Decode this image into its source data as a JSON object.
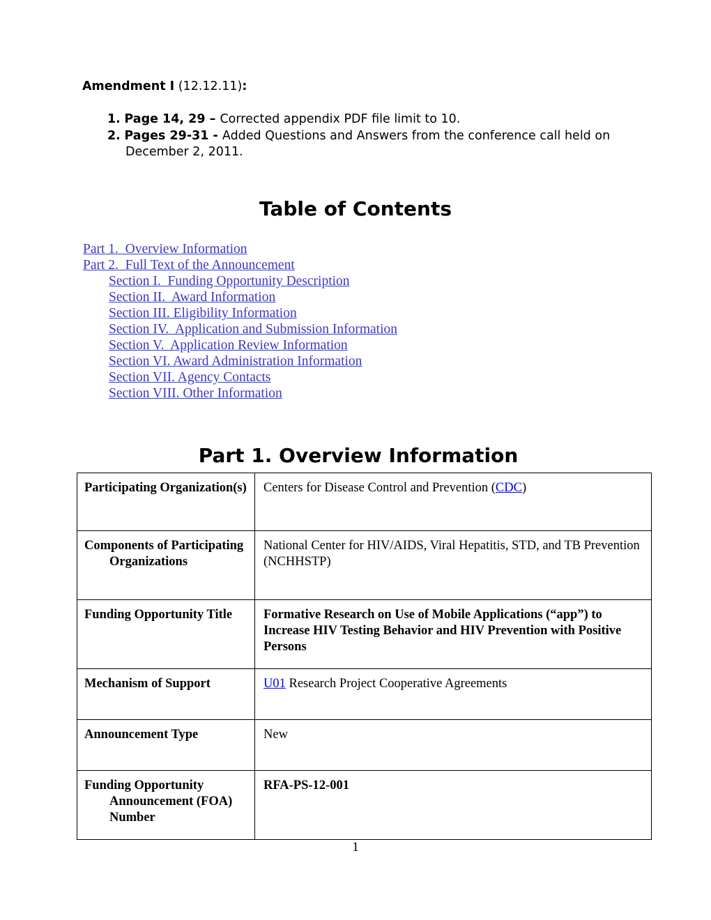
{
  "amendment": {
    "heading_strong": "Amendment I",
    "heading_plain": " (12.12.11)",
    "heading_colon": ":",
    "items": [
      {
        "number": "1.",
        "lead": "Page 14, 29 – ",
        "rest": "Corrected appendix PDF file limit to 10."
      },
      {
        "number": "2.",
        "lead": "Pages 29-31 - ",
        "rest": "Added Questions and Answers from the conference call held on December 2, 2011."
      }
    ]
  },
  "toc": {
    "heading": "Table of Contents",
    "link_color": "#3838C8",
    "entries": [
      {
        "label": "Part 1.  Overview Information",
        "level": 1
      },
      {
        "label": "Part 2.  Full Text of the Announcement",
        "level": 1
      },
      {
        "label": "Section I.  Funding Opportunity Description",
        "level": 2
      },
      {
        "label": "Section II.  Award Information",
        "level": 2
      },
      {
        "label": "Section III. Eligibility Information",
        "level": 2
      },
      {
        "label": "Section IV.  Application and Submission Information",
        "level": 2
      },
      {
        "label": "Section V.  Application Review Information",
        "level": 2
      },
      {
        "label": "Section VI. Award Administration Information",
        "level": 2
      },
      {
        "label": "Section VII. Agency Contacts",
        "level": 2
      },
      {
        "label": "Section VIII. Other Information",
        "level": 2
      }
    ]
  },
  "part1": {
    "heading": "Part 1. Overview Information",
    "table": {
      "rows": [
        {
          "label": "Participating Organization(s)",
          "value_before": "Centers for Disease Control and Prevention (",
          "value_link": "CDC",
          "value_after": ")",
          "bold_value": false
        },
        {
          "label": "Components of Participating Organizations",
          "value": "National Center for HIV/AIDS, Viral Hepatitis, STD, and TB Prevention (NCHHSTP)",
          "bold_value": false
        },
        {
          "label": "Funding Opportunity Title",
          "value": "Formative Research on Use of Mobile Applications (“app”) to Increase HIV Testing Behavior and HIV Prevention with Positive Persons",
          "bold_value": true
        },
        {
          "label": "Mechanism of Support",
          "value_link": "U01",
          "value_after": " Research Project Cooperative Agreements",
          "bold_value": false
        },
        {
          "label": "Announcement Type",
          "value": "New",
          "bold_value": false
        },
        {
          "label": "Funding Opportunity Announcement (FOA) Number",
          "value": "RFA-PS-12-001",
          "bold_value": true
        }
      ]
    }
  },
  "footer": {
    "page_number": "1"
  }
}
